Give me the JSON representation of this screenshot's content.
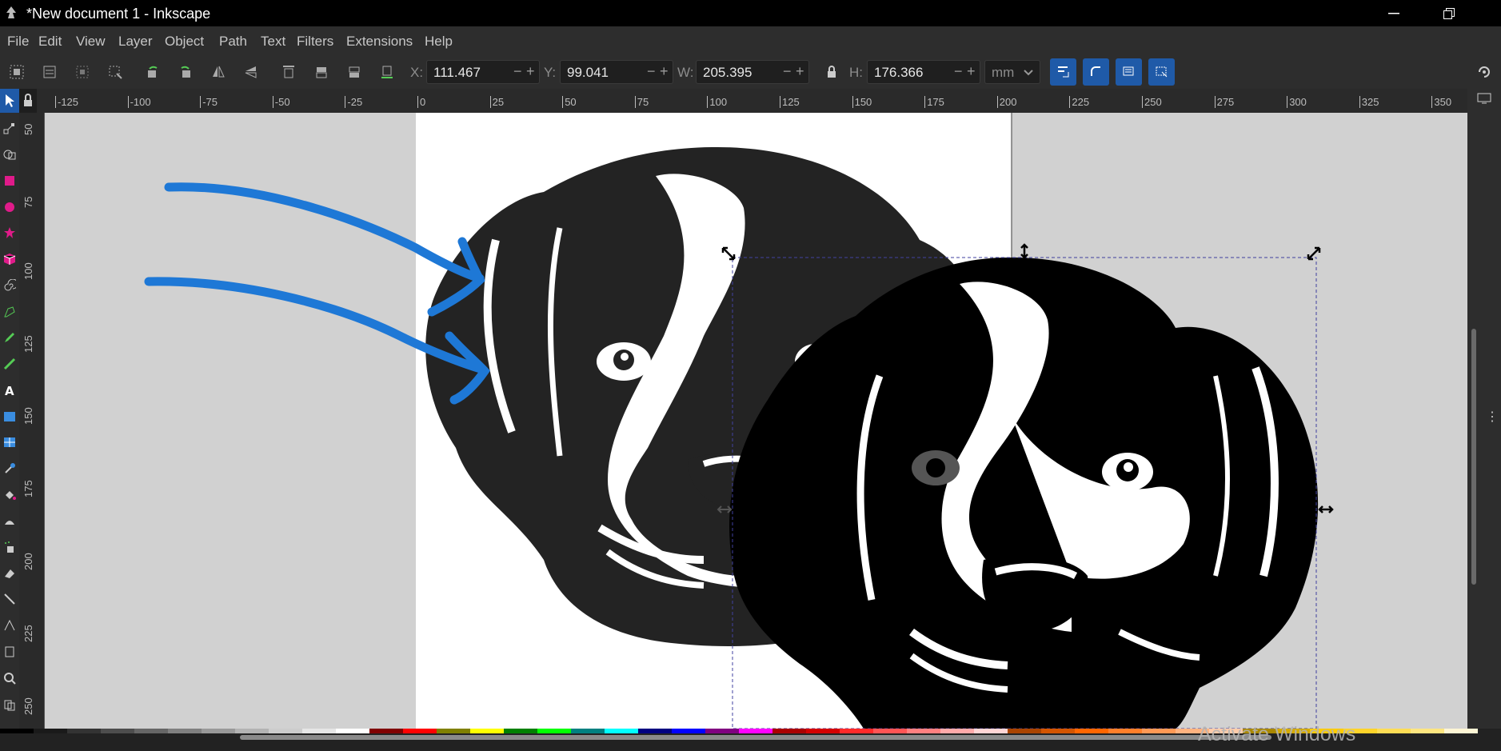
{
  "window": {
    "title": "*New document 1 - Inkscape",
    "minimize_icon": "minimize-icon",
    "restore_icon": "restore-icon"
  },
  "menu": [
    "File",
    "Edit",
    "View",
    "Layer",
    "Object",
    "Path",
    "Text",
    "Filters",
    "Extensions",
    "Help"
  ],
  "tool_controls": {
    "x_label": "X:",
    "x_value": "111.467",
    "y_label": "Y:",
    "y_value": "99.041",
    "w_label": "W:",
    "w_value": "205.395",
    "h_label": "H:",
    "h_value": "176.366",
    "unit": "mm",
    "minus": "−",
    "plus": "+"
  },
  "ruler_h": [
    "-125",
    "-100",
    "-75",
    "-50",
    "-25",
    "0",
    "25",
    "50",
    "75",
    "100",
    "125",
    "150",
    "175",
    "200",
    "225",
    "250",
    "275",
    "300",
    "325",
    "350"
  ],
  "ruler_v": [
    "50",
    "75",
    "100",
    "125",
    "150",
    "175",
    "200",
    "225",
    "250"
  ],
  "watermark": "Activate Windows",
  "colors": {
    "canvas_bg": "#d1d1d1",
    "page": "#ffffff",
    "arrow": "#1e78d6",
    "selection_dash": "#4040a0",
    "accent_button": "#1f5aa8"
  },
  "palette_colors": [
    "#000000",
    "#1a1a1a",
    "#333333",
    "#4d4d4d",
    "#666666",
    "#808080",
    "#999999",
    "#b3b3b3",
    "#cccccc",
    "#e6e6e6",
    "#ffffff",
    "#800000",
    "#ff0000",
    "#808000",
    "#ffff00",
    "#008000",
    "#00ff00",
    "#008080",
    "#00ffff",
    "#000080",
    "#0000ff",
    "#800080",
    "#ff00ff",
    "#aa0000",
    "#d40000",
    "#ff2a2a",
    "#ff5555",
    "#ff8080",
    "#ffaaaa",
    "#ffd5d5",
    "#aa4400",
    "#d45500",
    "#ff6600",
    "#ff7f2a",
    "#ff9955",
    "#ffb380",
    "#ffccaa",
    "#aa8800",
    "#d4aa00",
    "#ffcc00",
    "#ffd42a",
    "#ffdd55",
    "#ffe680",
    "#fff6d5"
  ]
}
